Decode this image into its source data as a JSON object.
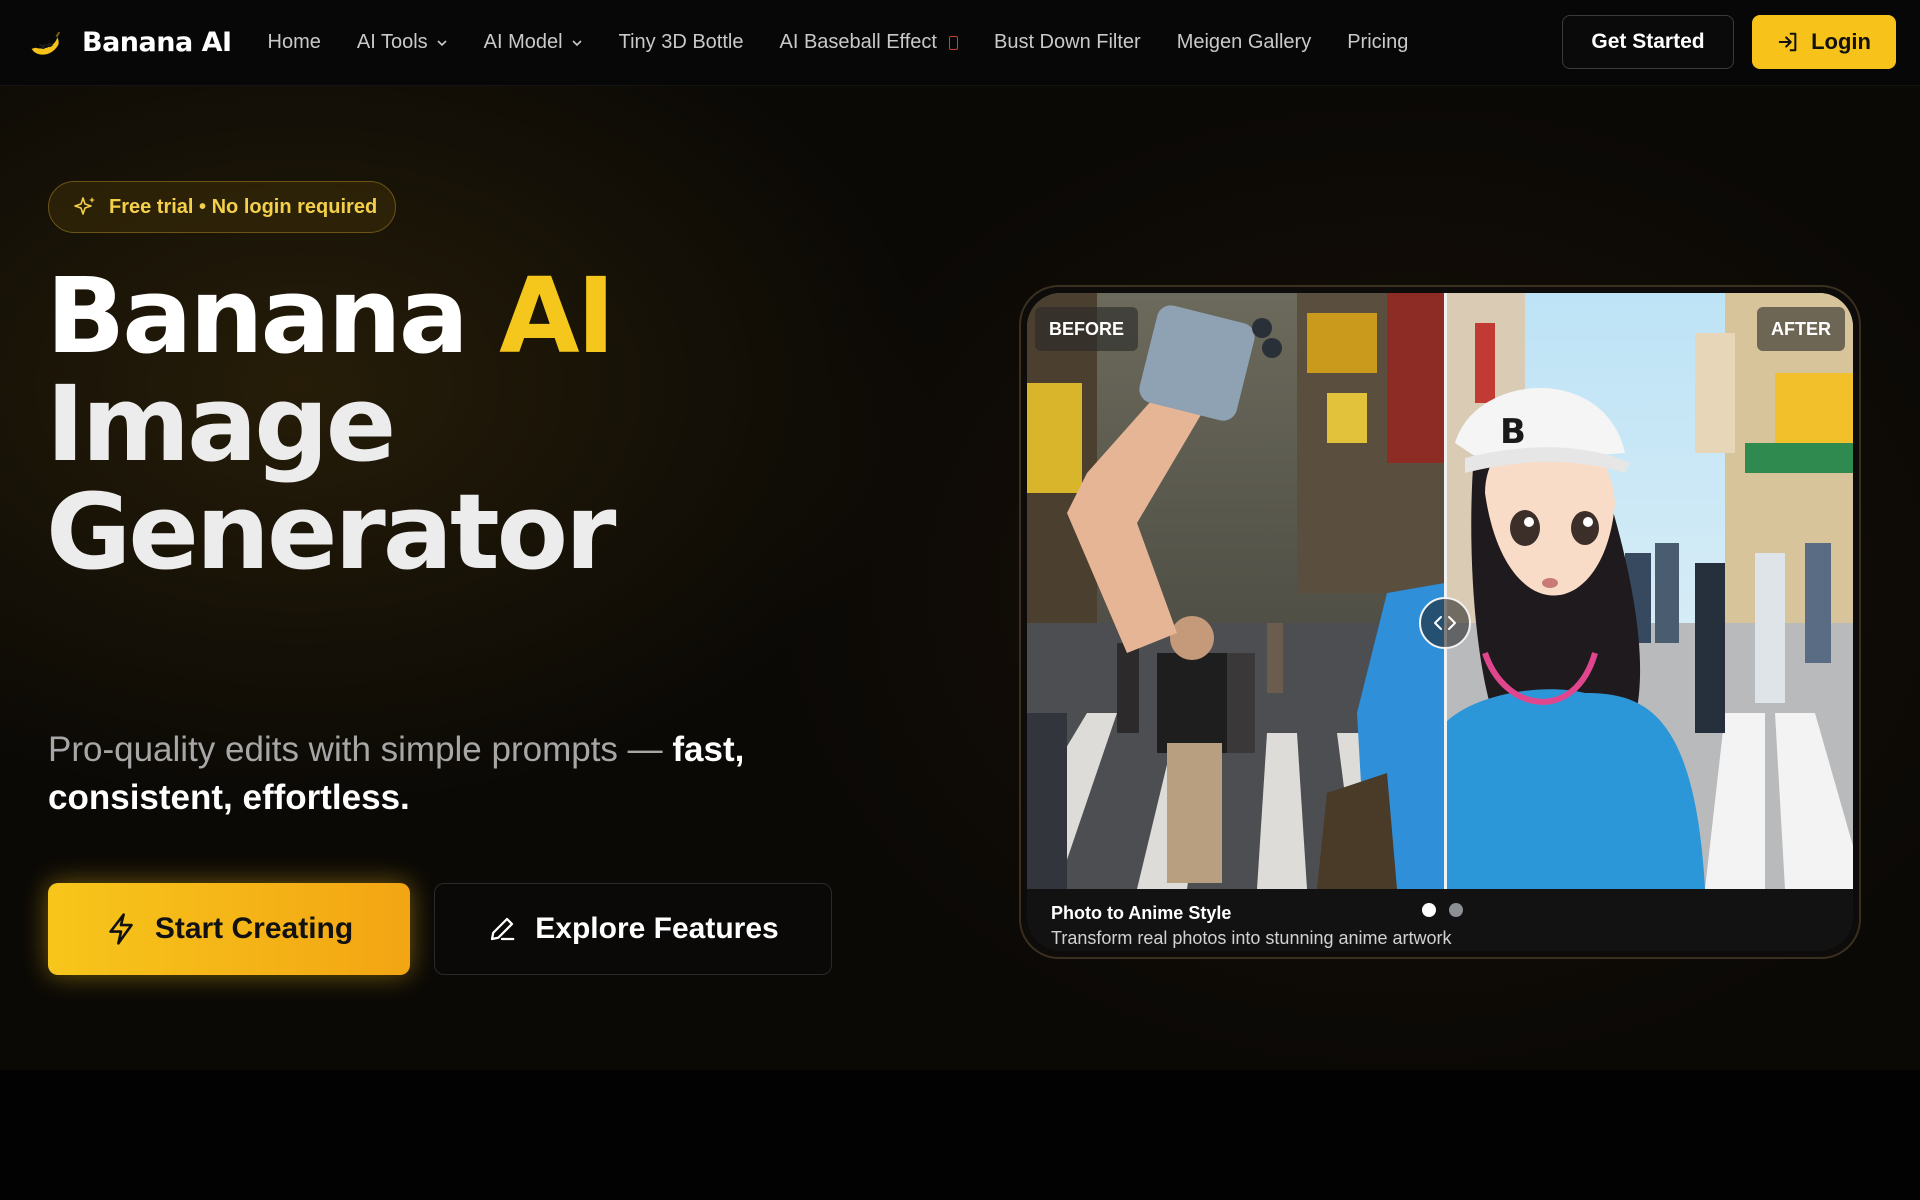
{
  "header": {
    "brand_name": "Banana AI",
    "logo_icon": "banana-icon",
    "nav": [
      {
        "label": "Home"
      },
      {
        "label": "AI Tools",
        "dropdown": true
      },
      {
        "label": "AI Model",
        "dropdown": true
      },
      {
        "label": "Tiny 3D Bottle"
      },
      {
        "label": "AI Baseball Effect"
      },
      {
        "label": "Bust Down Filter"
      },
      {
        "label": "Meigen Gallery"
      },
      {
        "label": "Pricing"
      }
    ],
    "get_started_label": "Get Started",
    "login_label": "Login"
  },
  "hero": {
    "badge_text": "Free trial • No login required",
    "headline_part1": "Banana ",
    "headline_accent": "AI",
    "headline_line2": "Image",
    "headline_line3": "Generator",
    "subline_normal": "Pro-quality edits with simple prompts — ",
    "subline_bold": "fast, consistent, effortless.",
    "start_label": "Start Creating",
    "explore_label": "Explore Features"
  },
  "compare": {
    "before_label": "BEFORE",
    "after_label": "AFTER",
    "caption_title": "Photo to Anime Style",
    "caption_desc": "Transform real photos into stunning anime artwork",
    "slides_total": 2,
    "active_slide": 1
  },
  "colors": {
    "accent": "#f5c61c",
    "background": "#0b0906"
  }
}
